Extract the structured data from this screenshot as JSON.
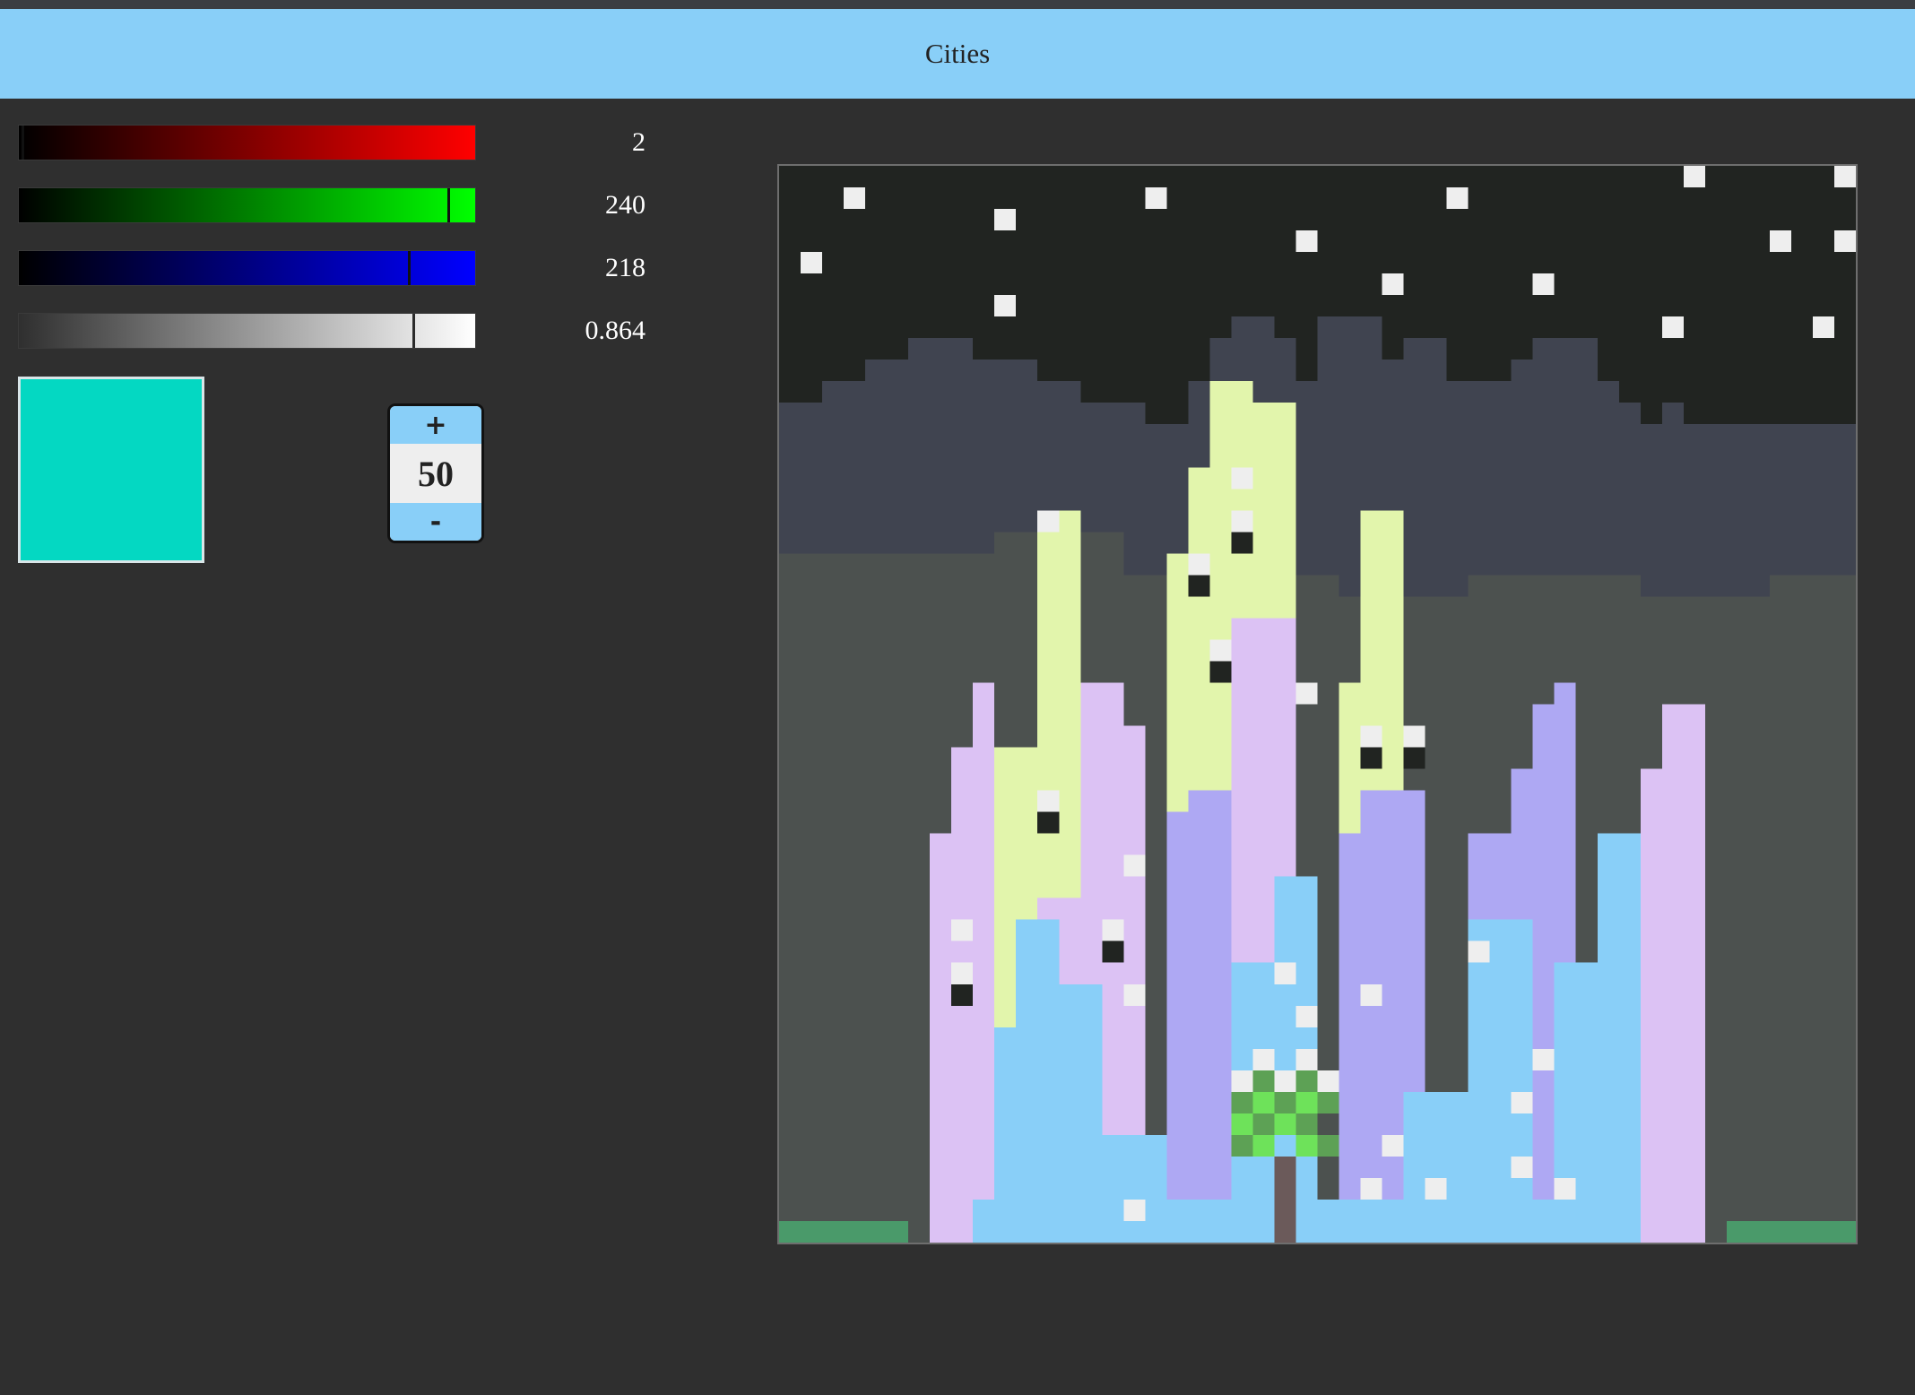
{
  "app": {
    "title": "Cities"
  },
  "sliders": {
    "red": {
      "value": "2",
      "max": 255
    },
    "green": {
      "value": "240",
      "max": 255
    },
    "blue": {
      "value": "218",
      "max": 255
    },
    "alpha": {
      "value": "0.864",
      "max": 1
    }
  },
  "preview": {
    "color": "#04d8c2"
  },
  "brush_stepper": {
    "plus_label": "+",
    "value": "50",
    "minus_label": "-"
  },
  "canvas": {
    "grid_size": 50,
    "palette": {
      "sky": "#212421",
      "star": "#eeeeee",
      "city_far": "#404450",
      "city_mid": "#4c514f",
      "yellow": "#e2f5ac",
      "pink": "#dcc2f4",
      "purple": "#aea8f3",
      "blue": "#89cff8",
      "window_dark": "#212421",
      "grass": "#4a9a6a",
      "trunk": "#6b5a5a",
      "leaf_light": "#6ee25a",
      "leaf_dark": "#5da155"
    }
  }
}
